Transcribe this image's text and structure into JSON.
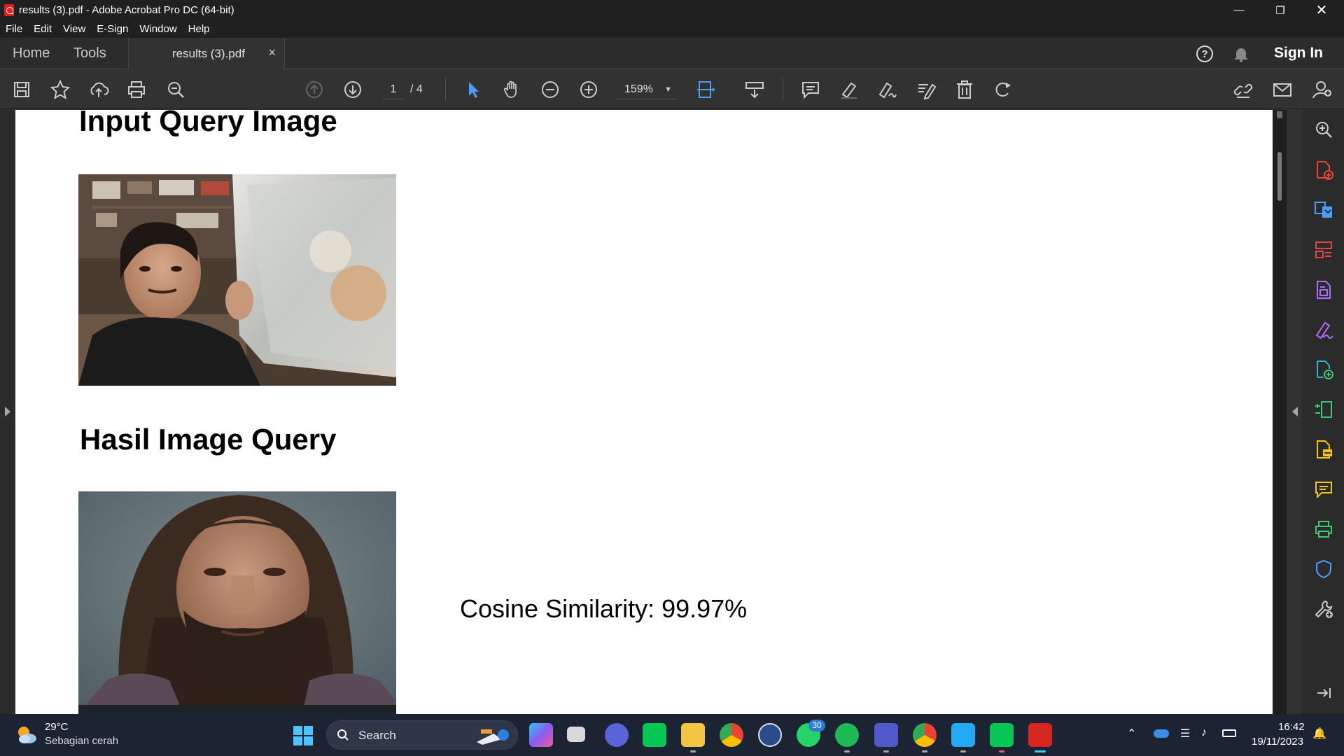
{
  "window": {
    "title": "results (3).pdf - Adobe Acrobat Pro DC (64-bit)"
  },
  "menu": [
    "File",
    "Edit",
    "View",
    "E-Sign",
    "Window",
    "Help"
  ],
  "tabs": {
    "home": "Home",
    "tools": "Tools",
    "document": "results (3).pdf",
    "close": "×"
  },
  "header": {
    "sign_in": "Sign In"
  },
  "toolbar": {
    "page_current": "1",
    "page_total": "/ 4",
    "zoom": "159%"
  },
  "document": {
    "heading_input": "Input Query Image",
    "heading_result": "Hasil Image Query",
    "cosine_text": "Cosine Similarity: 99.97%"
  },
  "icons": {
    "toolbar": [
      "save-icon",
      "bookmark-star-icon",
      "upload-icon",
      "print-icon",
      "find-zoom-icon",
      "page-up-icon",
      "page-down-icon",
      "select-cursor-icon",
      "hand-icon",
      "zoom-out-icon",
      "zoom-in-icon",
      "fit-page-icon",
      "scroll-mode-icon",
      "comment-icon",
      "highlight-icon",
      "sign-icon",
      "edit-icon",
      "delete-icon",
      "rotate-icon",
      "link-icon",
      "email-icon",
      "account-icon"
    ],
    "right_panel": [
      "search-zoom-icon",
      "create-pdf-icon",
      "export-pdf-icon",
      "organize-pages-icon",
      "edit-pdf-icon",
      "fill-sign-icon",
      "send-for-comments-icon",
      "compress-icon",
      "scan-ocr-icon",
      "comment-panel-icon",
      "print-production-icon",
      "protect-icon",
      "more-tools-icon",
      "collapse-panel-icon"
    ]
  },
  "colors": {
    "accent_blue": "#4a9eff",
    "acrobat_red": "#d7261f",
    "tool_red": "#e8453c",
    "tool_purple": "#b16bff",
    "tool_green": "#3ec872",
    "tool_yellow": "#f5c518",
    "tool_teal": "#2bb5c9"
  },
  "taskbar": {
    "weather_temp": "29°C",
    "weather_desc": "Sebagian cerah",
    "search_label": "Search",
    "whatsapp_badge": "30",
    "time": "16:42",
    "date": "19/11/2023"
  }
}
